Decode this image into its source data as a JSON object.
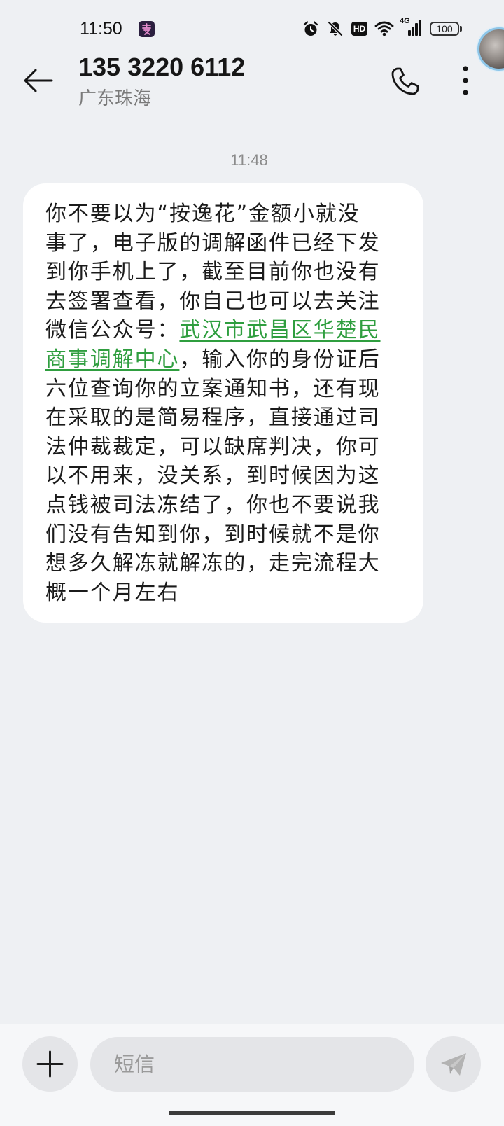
{
  "status_bar": {
    "time": "11:50",
    "hd_badge": "HD",
    "network": "4G",
    "battery": "100",
    "icons": [
      "app-notification-icon",
      "alarm-icon",
      "mute-bell-icon",
      "hd-icon",
      "wifi-icon",
      "signal-icon",
      "battery-icon"
    ]
  },
  "header": {
    "title": "135 3220 6112",
    "subtitle": "广东珠海",
    "icons": [
      "back-arrow-icon",
      "phone-icon",
      "more-vertical-icon"
    ]
  },
  "conversation": {
    "messages": [
      {
        "timestamp": "11:48",
        "direction": "incoming",
        "segments": [
          {
            "text": "你不要以为“按逸花”金额小就没事了，电子版的调解函件已经下发到你手机上了，截至目前你也没有去签署查看，你自己也可以去关注微信公众号：",
            "link": false
          },
          {
            "text": "武汉市武昌区华楚民商事调解中心",
            "link": true
          },
          {
            "text": "，输入你的身份证后六位查询你的立案通知书，还有现在采取的是简易程序，直接通过司法仲裁裁定，可以缺席判决，你可以不用来，没关系，到时候因为这点钱被司法冻结了，你也不要说我们没有告知到你，到时候就不是你想多久解冻就解冻的，走完流程大概一个月左右",
            "link": false
          }
        ]
      }
    ]
  },
  "composer": {
    "placeholder": "短信",
    "icons": [
      "plus-icon",
      "send-icon"
    ]
  },
  "colors": {
    "background": "#eef0f3",
    "bubble": "#ffffff",
    "link": "#2f9e3f",
    "composer": "#f6f7f9"
  }
}
